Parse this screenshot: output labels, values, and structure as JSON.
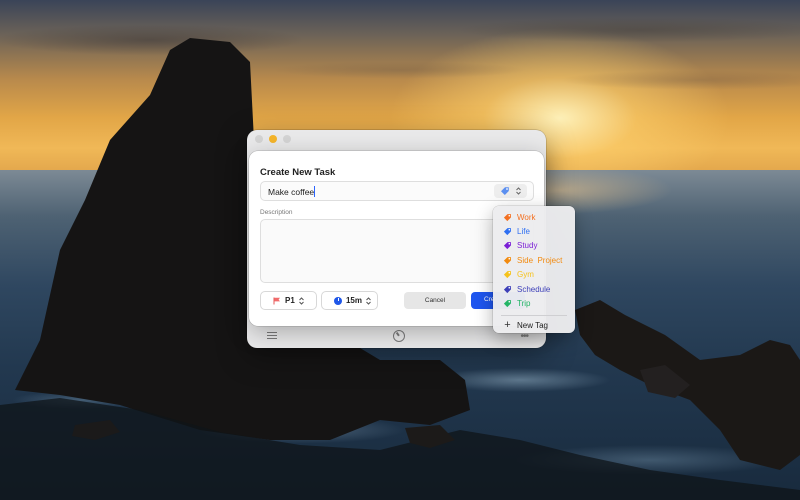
{
  "dialog": {
    "title": "Create New Task",
    "task_value": "Make coffee",
    "tag_icon": "tag-icon",
    "description_label": "Description",
    "description_value": "",
    "priority": {
      "label": "P1",
      "icon": "flag-icon",
      "color": "#f26b6b"
    },
    "duration": {
      "label": "15m",
      "icon": "clock-icon",
      "color": "#1f57e8"
    },
    "cancel_label": "Cancel",
    "create_label": "Cre"
  },
  "tag_menu": {
    "items": [
      {
        "label": "Work",
        "color": "#f37021"
      },
      {
        "label": "Life",
        "color": "#2e6ff2"
      },
      {
        "label": "Study",
        "color": "#7b1fd6"
      },
      {
        "label": "Side  Project",
        "color": "#f28a0f"
      },
      {
        "label": "Gym",
        "color": "#f5c21b"
      },
      {
        "label": "Schedule",
        "color": "#3d3fb8"
      },
      {
        "label": "Trip",
        "color": "#23b466"
      }
    ],
    "new_tag_label": "New Tag"
  },
  "back_window": {
    "toolbar_icons": [
      "list-icon",
      "timer-icon",
      "more-icon"
    ]
  },
  "colors": {
    "accent": "#1f56ef",
    "traffic_yellow": "#f5b52a"
  }
}
